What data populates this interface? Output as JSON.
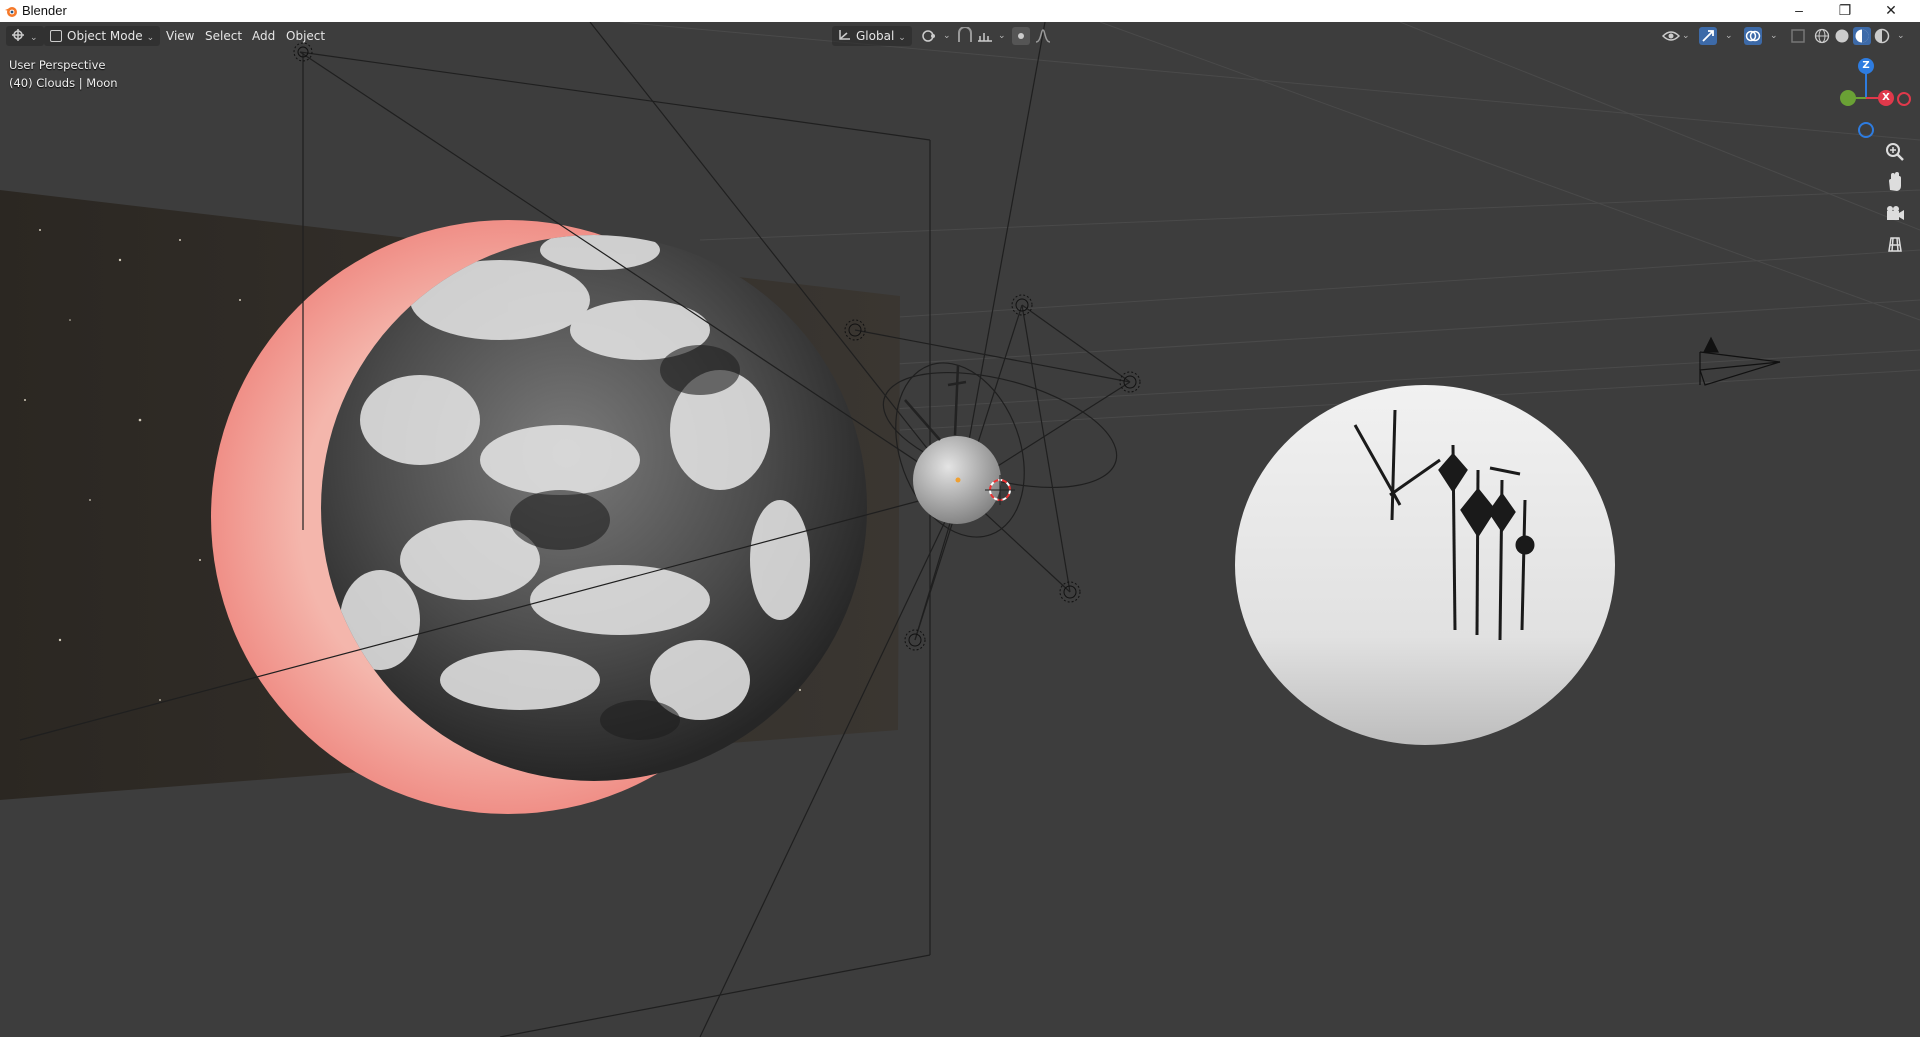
{
  "window": {
    "title": "Blender",
    "controls": [
      "–",
      "❐",
      "✕"
    ]
  },
  "header": {
    "editor_type_icon": "viewport-editor-icon",
    "mode": "Object Mode",
    "menus": [
      "View",
      "Select",
      "Add",
      "Object"
    ],
    "transform_orientation": "Global"
  },
  "viewport_overlay": {
    "view_name": "User Perspective",
    "object_info": "(40) Clouds | Moon"
  },
  "navigation_gizmo": {
    "axes": [
      "Z",
      "X",
      "Y"
    ],
    "colors": {
      "x": "#e0394b",
      "y": "#6aa135",
      "z": "#2e7ce0"
    }
  },
  "colors": {
    "viewport_bg": "#3d3d3d",
    "header_bg": "#3d3d3d",
    "title_bar": "#ffffff",
    "accent": "#4a90e2"
  }
}
